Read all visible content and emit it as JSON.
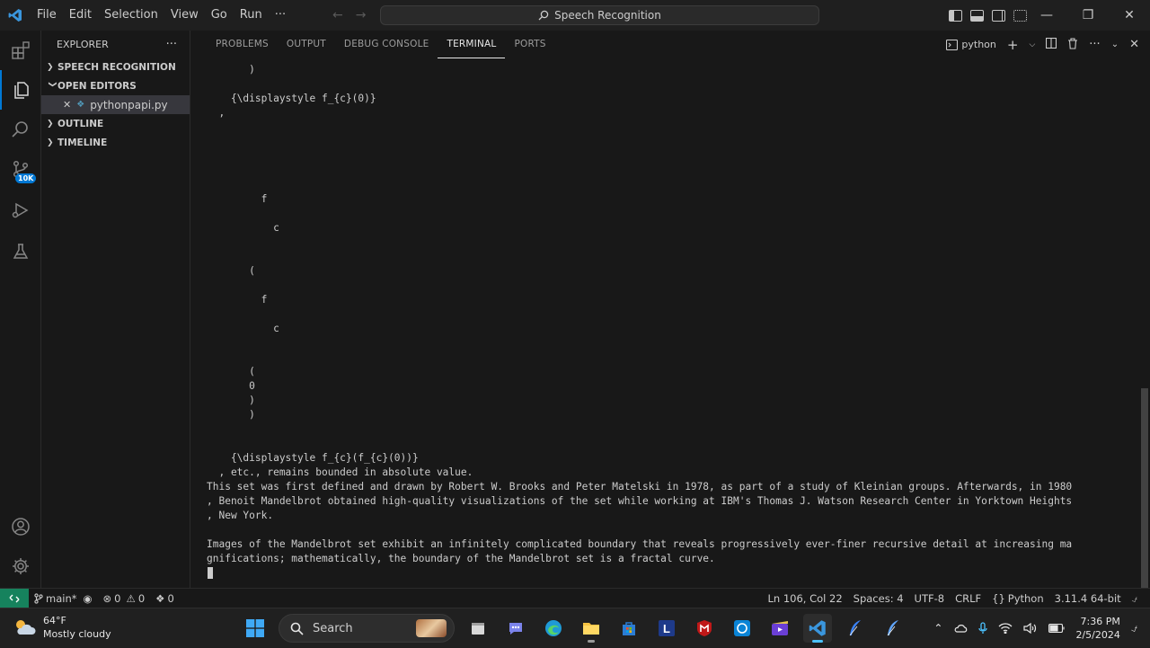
{
  "titlebar": {
    "menus": [
      "File",
      "Edit",
      "Selection",
      "View",
      "Go",
      "Run",
      "···"
    ],
    "search_text": "Speech Recognition"
  },
  "sidebar": {
    "header": "EXPLORER",
    "more": "···",
    "sections": {
      "project": "SPEECH RECOGNITION",
      "open_editors": "OPEN EDITORS",
      "open_file": "pythonpapi.py",
      "outline": "OUTLINE",
      "timeline": "TIMELINE"
    }
  },
  "activity": {
    "badge": "10K"
  },
  "panel": {
    "tabs": [
      "PROBLEMS",
      "OUTPUT",
      "DEBUG CONSOLE",
      "TERMINAL",
      "PORTS"
    ],
    "active_tab": "TERMINAL",
    "terminal_name": "python"
  },
  "terminal": {
    "lines": [
      {
        "t": "       )"
      },
      {
        "t": ""
      },
      {
        "t": "    {\\displaystyle f_{c}(0)}"
      },
      {
        "t": "  ,"
      },
      {
        "t": ""
      },
      {
        "t": ""
      },
      {
        "t": ""
      },
      {
        "t": ""
      },
      {
        "t": ""
      },
      {
        "t": "         f"
      },
      {
        "t": ""
      },
      {
        "t": "           c"
      },
      {
        "t": ""
      },
      {
        "t": ""
      },
      {
        "t": "       ("
      },
      {
        "t": ""
      },
      {
        "t": "         f"
      },
      {
        "t": ""
      },
      {
        "t": "           c"
      },
      {
        "t": ""
      },
      {
        "t": ""
      },
      {
        "t": "       ("
      },
      {
        "t": "       0"
      },
      {
        "t": "       )"
      },
      {
        "t": "       )"
      },
      {
        "t": ""
      },
      {
        "t": ""
      },
      {
        "t": "    {\\displaystyle f_{c}(f_{c}(0))}"
      },
      {
        "t": "  , etc., remains bounded in absolute value."
      },
      {
        "t": "This set was first defined and drawn by Robert W. Brooks and Peter Matelski in 1978, as part of a study of Kleinian groups. Afterwards, in 1980"
      },
      {
        "t": ", Benoit Mandelbrot obtained high-quality visualizations of the set while working at IBM's Thomas J. Watson Research Center in Yorktown Heights"
      },
      {
        "t": ", New York."
      },
      {
        "t": ""
      },
      {
        "t": "Images of the Mandelbrot set exhibit an infinitely complicated boundary that reveals progressively ever-finer recursive detail at increasing ma"
      },
      {
        "t": "gnifications; mathematically, the boundary of the Mandelbrot set is a fractal curve."
      }
    ]
  },
  "statusbar": {
    "branch": "main*",
    "errors": "0",
    "warnings": "0",
    "ports": "0",
    "position": "Ln 106, Col 22",
    "spaces": "Spaces: 4",
    "encoding": "UTF-8",
    "eol": "CRLF",
    "language": "Python",
    "interpreter": "3.11.4 64-bit"
  },
  "taskbar": {
    "temperature": "64°F",
    "weather": "Mostly cloudy",
    "search_placeholder": "Search",
    "time": "7:36 PM",
    "date": "2/5/2024"
  },
  "colors": {
    "accent": "#0078d4",
    "remote": "#16825d",
    "background": "#181818"
  }
}
